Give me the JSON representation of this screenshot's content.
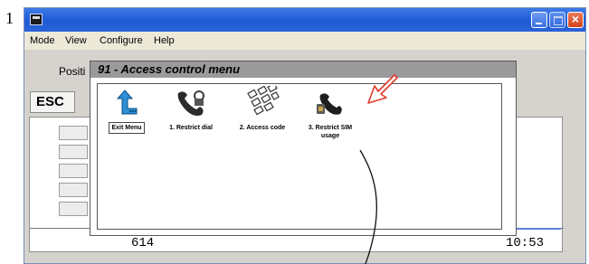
{
  "step_number": "1",
  "window": {
    "menus": [
      "Mode",
      "View",
      "Configure",
      "Help"
    ],
    "left_label": "Positi",
    "esc_label": "ESC",
    "left_value": "614",
    "right_value": "10:53"
  },
  "popup": {
    "title": "91 - Access control menu",
    "items": [
      {
        "label": "Exit Menu",
        "icon": "exit-arrow-icon"
      },
      {
        "label": "1. Restrict dial",
        "icon": "phone-lock-icon"
      },
      {
        "label": "2. Access code",
        "icon": "keypad-icon"
      },
      {
        "label": "3. Restrict SIM usage",
        "icon": "sim-restrict-icon"
      }
    ]
  },
  "colors": {
    "titlebar": "#2a63d8",
    "annotation_arrow": "#e23b2e",
    "popup_header": "#9a9a9a"
  }
}
